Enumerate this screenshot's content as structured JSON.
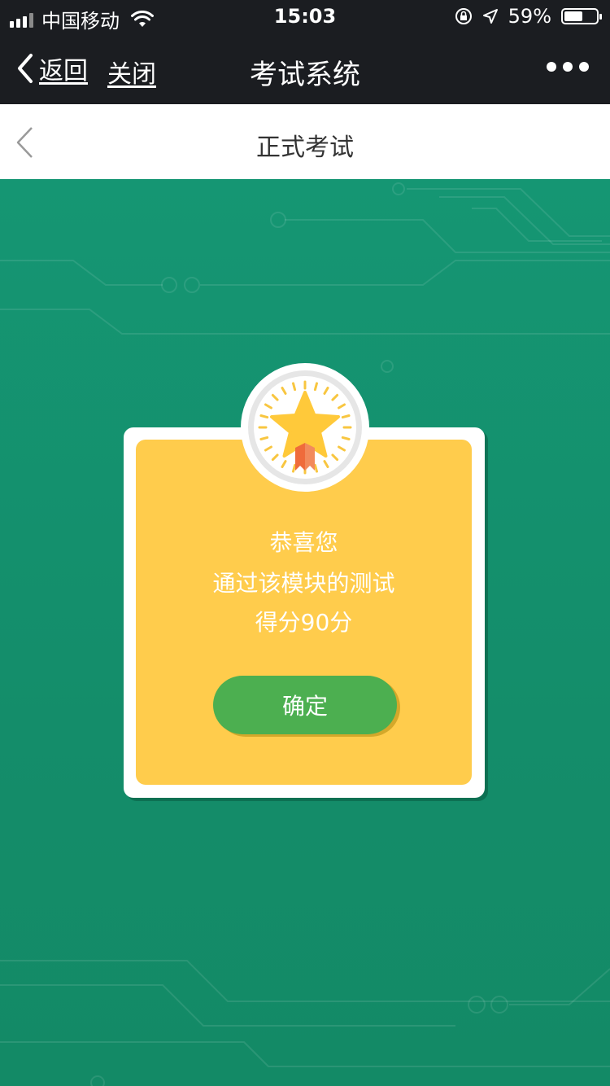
{
  "status_bar": {
    "carrier": "中国移动",
    "time": "15:03",
    "battery": "59%",
    "battery_level": 0.59
  },
  "nav": {
    "back_label": "返回",
    "close_label": "关闭",
    "title": "考试系统"
  },
  "header": {
    "title": "正式考试"
  },
  "dialog": {
    "line1": "恭喜您",
    "line2": "通过该模块的测试",
    "line3": "得分90分",
    "confirm_label": "确定"
  },
  "colors": {
    "background": "#148d6a",
    "card": "#ffcc4c",
    "button": "#4caf50",
    "star": "#ffcc33",
    "ribbon": "#ef6b3b"
  },
  "icons": [
    "signal-icon",
    "wifi-icon",
    "orientation-lock-icon",
    "location-icon",
    "battery-icon",
    "back-chevron-icon",
    "more-icon",
    "star-medal-icon"
  ]
}
